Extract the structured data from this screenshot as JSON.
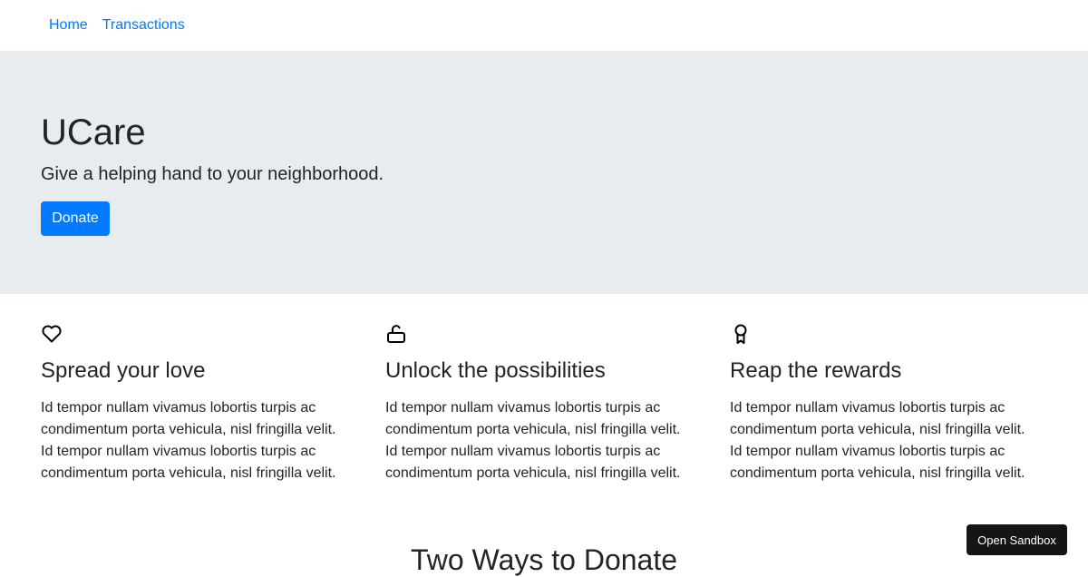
{
  "nav": {
    "items": [
      {
        "label": "Home"
      },
      {
        "label": "Transactions"
      }
    ]
  },
  "hero": {
    "title": "UCare",
    "tagline": "Give a helping hand to your neighborhood.",
    "donate_label": "Donate",
    "background": "#e9ecef",
    "accent": "#007bff"
  },
  "features": [
    {
      "icon": "heart-icon",
      "title": "Spread your love",
      "body": "Id tempor nullam vivamus lobortis turpis ac condimentum porta vehicula, nisl fringilla velit. Id tempor nullam vivamus lobortis turpis ac condimentum porta vehicula, nisl fringilla velit."
    },
    {
      "icon": "unlock-icon",
      "title": "Unlock the possibilities",
      "body": "Id tempor nullam vivamus lobortis turpis ac condimentum porta vehicula, nisl fringilla velit. Id tempor nullam vivamus lobortis turpis ac condimentum porta vehicula, nisl fringilla velit."
    },
    {
      "icon": "award-icon",
      "title": "Reap the rewards",
      "body": "Id tempor nullam vivamus lobortis turpis ac condimentum porta vehicula, nisl fringilla velit. Id tempor nullam vivamus lobortis turpis ac condimentum porta vehicula, nisl fringilla velit."
    }
  ],
  "section": {
    "title": "Two Ways to Donate"
  },
  "sandbox": {
    "label": "Open Sandbox"
  }
}
